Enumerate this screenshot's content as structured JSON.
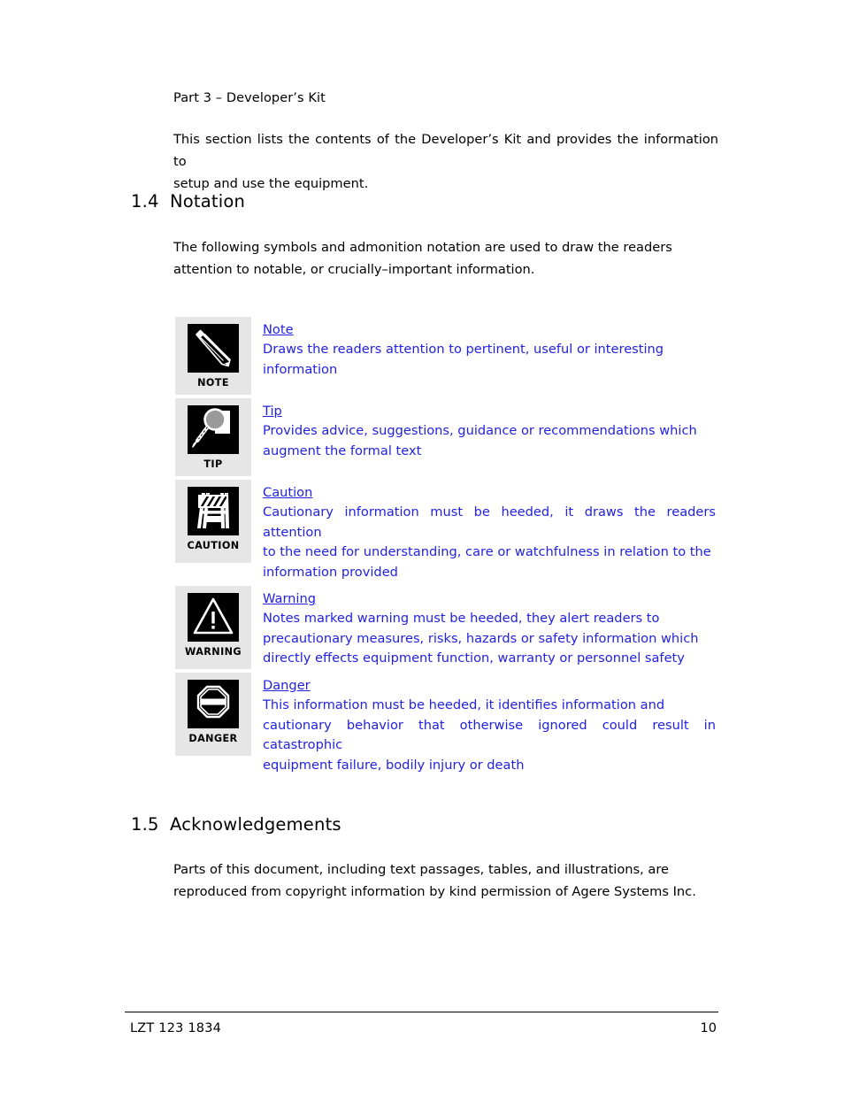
{
  "document": {
    "part_heading": "Part 3 – Developer’s Kit",
    "intro_line1": "This section lists the contents of the Developer’s Kit and provides the information to",
    "intro_line2": "setup and use the equipment."
  },
  "sections": {
    "notation": {
      "number": "1.4",
      "title": "Notation",
      "paragraph_line1": "The following symbols and admonition notation are used to draw the readers",
      "paragraph_line2": "attention to notable, or crucially–important information."
    },
    "acknowledgements": {
      "number": "1.5",
      "title": "Acknowledgements",
      "paragraph_line1": "Parts of this document, including text passages, tables, and illustrations, are",
      "paragraph_line2": "reproduced from copyright information by kind permission of Agere Systems Inc."
    }
  },
  "notation_rows": [
    {
      "icon": "pencil-icon",
      "icon_label": "NOTE",
      "title": "Note",
      "body_line1": "Draws the readers attention to pertinent, useful or interesting",
      "body_line2": "information"
    },
    {
      "icon": "magnifier-icon",
      "icon_label": "TIP",
      "title": "Tip",
      "body_line1": "Provides advice, suggestions, guidance or recommendations which",
      "body_line2": "augment the formal text"
    },
    {
      "icon": "barricade-icon",
      "icon_label": "CAUTION",
      "title": "Caution",
      "body_line1": "Cautionary information must be heeded, it draws the readers attention",
      "body_line2": "to the need for understanding, care or watchfulness in relation to the",
      "body_line3": "information provided"
    },
    {
      "icon": "warning-triangle-icon",
      "icon_label": "WARNING",
      "title": "Warning",
      "body_line1": "Notes marked warning must be heeded, they alert readers to",
      "body_line2": "precautionary measures,  risks, hazards or safety information which",
      "body_line3": "directly effects equipment function, warranty or personnel safety"
    },
    {
      "icon": "octagon-stop-icon",
      "icon_label": "DANGER",
      "title": "Danger",
      "body_line1": "This information must be heeded, it identifies information and",
      "body_line2": "cautionary behavior that otherwise ignored could result in catastrophic",
      "body_line3": "equipment failure, bodily injury or death"
    }
  ],
  "footer": {
    "document_number": "LZT 123 1834",
    "page_number": "10"
  },
  "colors": {
    "notation_text": "#2222e0",
    "icon_cell_background": "#e6e6e6",
    "icon_background": "#000000",
    "body_text": "#000000"
  }
}
